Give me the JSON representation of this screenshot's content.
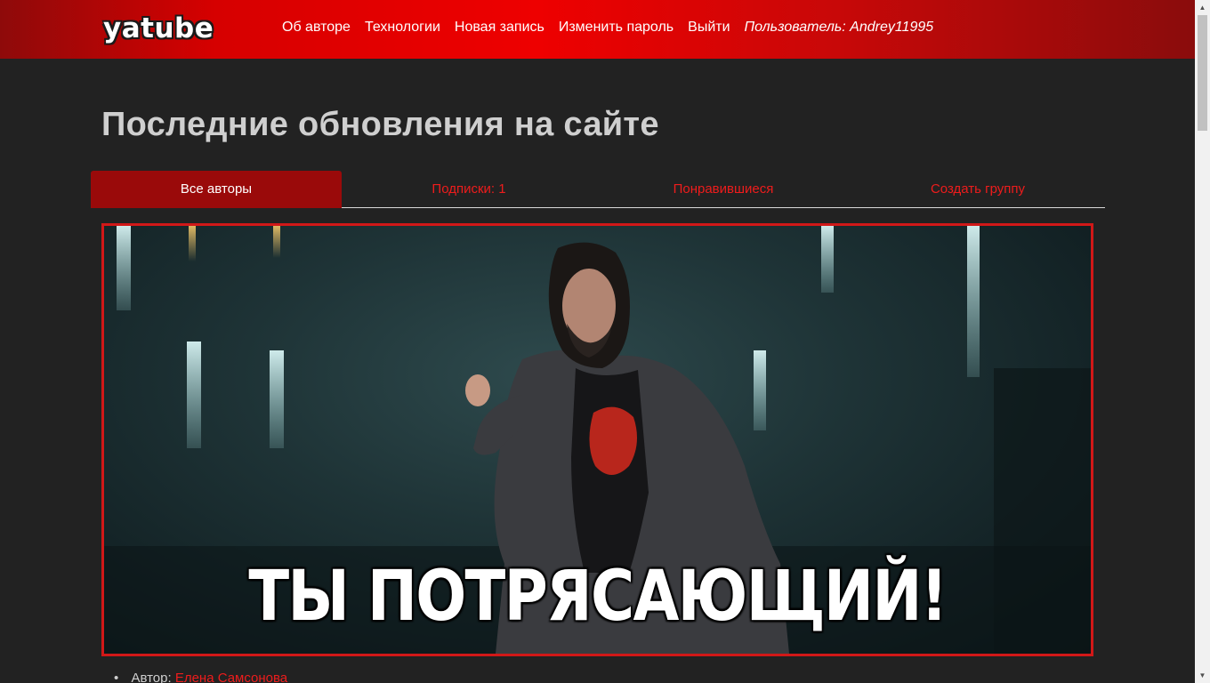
{
  "header": {
    "logo": "yatube",
    "nav": {
      "about": "Об авторе",
      "tech": "Технологии",
      "new_post": "Новая запись",
      "change_password": "Изменить пароль",
      "logout": "Выйти",
      "user": "Пользователь: Andrey11995"
    }
  },
  "main": {
    "title": "Последние обновления на сайте",
    "tabs": [
      {
        "label": "Все авторы",
        "active": true
      },
      {
        "label": "Подписки: 1",
        "active": false
      },
      {
        "label": "Понравившиеся",
        "active": false
      },
      {
        "label": "Создать группу",
        "active": false
      }
    ],
    "post": {
      "image_caption": "ТЫ ПОТРЯСАЮЩИЙ!",
      "author_label": "Автор:",
      "author_name": "Елена Самсонова"
    }
  },
  "colors": {
    "accent": "#ee1c1c",
    "header_red": "#e00000",
    "active_tab": "#9a0a0a",
    "background": "#222222"
  }
}
